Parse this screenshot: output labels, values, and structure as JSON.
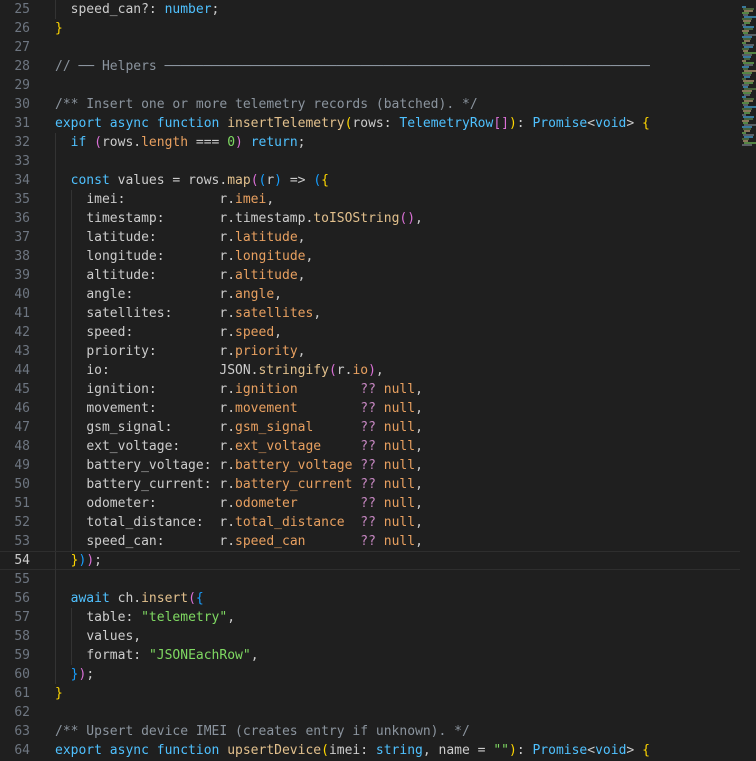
{
  "editor": {
    "language": "typescript",
    "current_line": 54,
    "colors": {
      "background": "#1f1f1f",
      "line_number": "#6e7681",
      "keyword": "#4fc1ff",
      "function": "#e2c08d",
      "property": "#e8a060",
      "string": "#7fd962",
      "comment": "#8b949e",
      "operator": "#c586c0"
    },
    "lines": [
      {
        "n": "25",
        "indent": 1,
        "tokens": [
          [
            "ident",
            "speed_can?: "
          ],
          [
            "kw",
            "number"
          ],
          [
            "ident",
            ";"
          ]
        ]
      },
      {
        "n": "26",
        "indent": 0,
        "tokens": [
          [
            "br1",
            "}"
          ]
        ]
      },
      {
        "n": "27",
        "indent": 0,
        "tokens": []
      },
      {
        "n": "28",
        "indent": 0,
        "tokens": [
          [
            "com",
            "// ── Helpers ──────────────────────────────────────────────────────────────"
          ]
        ]
      },
      {
        "n": "29",
        "indent": 0,
        "tokens": []
      },
      {
        "n": "30",
        "indent": 0,
        "tokens": [
          [
            "com",
            "/** Insert one or more telemetry records (batched). */"
          ]
        ]
      },
      {
        "n": "31",
        "indent": 0,
        "tokens": [
          [
            "kw",
            "export async function "
          ],
          [
            "fn",
            "insertTelemetry"
          ],
          [
            "br1",
            "("
          ],
          [
            "ident",
            "rows: "
          ],
          [
            "ty",
            "TelemetryRow"
          ],
          [
            "br2",
            "[]"
          ],
          [
            "br1",
            ")"
          ],
          [
            "ident",
            ": "
          ],
          [
            "ty",
            "Promise"
          ],
          [
            "ident",
            "<"
          ],
          [
            "ty",
            "void"
          ],
          [
            "ident",
            "> "
          ],
          [
            "br1",
            "{"
          ]
        ]
      },
      {
        "n": "32",
        "indent": 1,
        "tokens": [
          [
            "kw",
            "if "
          ],
          [
            "br2",
            "("
          ],
          [
            "ident",
            "rows."
          ],
          [
            "prop",
            "length"
          ],
          [
            "ident",
            " === "
          ],
          [
            "num",
            "0"
          ],
          [
            "br2",
            ")"
          ],
          [
            "ident",
            " "
          ],
          [
            "kw",
            "return"
          ],
          [
            "ident",
            ";"
          ]
        ]
      },
      {
        "n": "33",
        "indent": 1,
        "tokens": []
      },
      {
        "n": "34",
        "indent": 1,
        "tokens": [
          [
            "kw",
            "const "
          ],
          [
            "ident",
            "values = rows."
          ],
          [
            "fn",
            "map"
          ],
          [
            "br2",
            "("
          ],
          [
            "br3",
            "("
          ],
          [
            "ident",
            "r"
          ],
          [
            "br3",
            ")"
          ],
          [
            "ident",
            " => "
          ],
          [
            "br3",
            "("
          ],
          [
            "br1",
            "{"
          ]
        ]
      },
      {
        "n": "35",
        "indent": 2,
        "tokens": [
          [
            "ident",
            "imei:            r."
          ],
          [
            "prop",
            "imei"
          ],
          [
            "ident",
            ","
          ]
        ]
      },
      {
        "n": "36",
        "indent": 2,
        "tokens": [
          [
            "ident",
            "timestamp:       r.timestamp."
          ],
          [
            "fn",
            "toISOString"
          ],
          [
            "br2",
            "()"
          ],
          [
            "ident",
            ","
          ]
        ]
      },
      {
        "n": "37",
        "indent": 2,
        "tokens": [
          [
            "ident",
            "latitude:        r."
          ],
          [
            "prop",
            "latitude"
          ],
          [
            "ident",
            ","
          ]
        ]
      },
      {
        "n": "38",
        "indent": 2,
        "tokens": [
          [
            "ident",
            "longitude:       r."
          ],
          [
            "prop",
            "longitude"
          ],
          [
            "ident",
            ","
          ]
        ]
      },
      {
        "n": "39",
        "indent": 2,
        "tokens": [
          [
            "ident",
            "altitude:        r."
          ],
          [
            "prop",
            "altitude"
          ],
          [
            "ident",
            ","
          ]
        ]
      },
      {
        "n": "40",
        "indent": 2,
        "tokens": [
          [
            "ident",
            "angle:           r."
          ],
          [
            "prop",
            "angle"
          ],
          [
            "ident",
            ","
          ]
        ]
      },
      {
        "n": "41",
        "indent": 2,
        "tokens": [
          [
            "ident",
            "satellites:      r."
          ],
          [
            "prop",
            "satellites"
          ],
          [
            "ident",
            ","
          ]
        ]
      },
      {
        "n": "42",
        "indent": 2,
        "tokens": [
          [
            "ident",
            "speed:           r."
          ],
          [
            "prop",
            "speed"
          ],
          [
            "ident",
            ","
          ]
        ]
      },
      {
        "n": "43",
        "indent": 2,
        "tokens": [
          [
            "ident",
            "priority:        r."
          ],
          [
            "prop",
            "priority"
          ],
          [
            "ident",
            ","
          ]
        ]
      },
      {
        "n": "44",
        "indent": 2,
        "tokens": [
          [
            "ident",
            "io:              JSON."
          ],
          [
            "fn",
            "stringify"
          ],
          [
            "br2",
            "("
          ],
          [
            "ident",
            "r."
          ],
          [
            "prop",
            "io"
          ],
          [
            "br2",
            ")"
          ],
          [
            "ident",
            ","
          ]
        ]
      },
      {
        "n": "45",
        "indent": 2,
        "tokens": [
          [
            "ident",
            "ignition:        r."
          ],
          [
            "prop",
            "ignition        "
          ],
          [
            "opq",
            "??"
          ],
          [
            "ident",
            " "
          ],
          [
            "null",
            "null"
          ],
          [
            "ident",
            ","
          ]
        ]
      },
      {
        "n": "46",
        "indent": 2,
        "tokens": [
          [
            "ident",
            "movement:        r."
          ],
          [
            "prop",
            "movement        "
          ],
          [
            "opq",
            "??"
          ],
          [
            "ident",
            " "
          ],
          [
            "null",
            "null"
          ],
          [
            "ident",
            ","
          ]
        ]
      },
      {
        "n": "47",
        "indent": 2,
        "tokens": [
          [
            "ident",
            "gsm_signal:      r."
          ],
          [
            "prop",
            "gsm_signal      "
          ],
          [
            "opq",
            "??"
          ],
          [
            "ident",
            " "
          ],
          [
            "null",
            "null"
          ],
          [
            "ident",
            ","
          ]
        ]
      },
      {
        "n": "48",
        "indent": 2,
        "tokens": [
          [
            "ident",
            "ext_voltage:     r."
          ],
          [
            "prop",
            "ext_voltage     "
          ],
          [
            "opq",
            "??"
          ],
          [
            "ident",
            " "
          ],
          [
            "null",
            "null"
          ],
          [
            "ident",
            ","
          ]
        ]
      },
      {
        "n": "49",
        "indent": 2,
        "tokens": [
          [
            "ident",
            "battery_voltage: r."
          ],
          [
            "prop",
            "battery_voltage "
          ],
          [
            "opq",
            "??"
          ],
          [
            "ident",
            " "
          ],
          [
            "null",
            "null"
          ],
          [
            "ident",
            ","
          ]
        ]
      },
      {
        "n": "50",
        "indent": 2,
        "tokens": [
          [
            "ident",
            "battery_current: r."
          ],
          [
            "prop",
            "battery_current "
          ],
          [
            "opq",
            "??"
          ],
          [
            "ident",
            " "
          ],
          [
            "null",
            "null"
          ],
          [
            "ident",
            ","
          ]
        ]
      },
      {
        "n": "51",
        "indent": 2,
        "tokens": [
          [
            "ident",
            "odometer:        r."
          ],
          [
            "prop",
            "odometer        "
          ],
          [
            "opq",
            "??"
          ],
          [
            "ident",
            " "
          ],
          [
            "null",
            "null"
          ],
          [
            "ident",
            ","
          ]
        ]
      },
      {
        "n": "52",
        "indent": 2,
        "tokens": [
          [
            "ident",
            "total_distance:  r."
          ],
          [
            "prop",
            "total_distance  "
          ],
          [
            "opq",
            "??"
          ],
          [
            "ident",
            " "
          ],
          [
            "null",
            "null"
          ],
          [
            "ident",
            ","
          ]
        ]
      },
      {
        "n": "53",
        "indent": 2,
        "tokens": [
          [
            "ident",
            "speed_can:       r."
          ],
          [
            "prop",
            "speed_can       "
          ],
          [
            "opq",
            "??"
          ],
          [
            "ident",
            " "
          ],
          [
            "null",
            "null"
          ],
          [
            "ident",
            ","
          ]
        ]
      },
      {
        "n": "54",
        "indent": 1,
        "tokens": [
          [
            "br1",
            "}"
          ],
          [
            "br3",
            ")"
          ],
          [
            "br2",
            ")"
          ],
          [
            "ident",
            ";"
          ]
        ]
      },
      {
        "n": "55",
        "indent": 1,
        "tokens": []
      },
      {
        "n": "56",
        "indent": 1,
        "tokens": [
          [
            "kw",
            "await "
          ],
          [
            "ident",
            "ch."
          ],
          [
            "fn",
            "insert"
          ],
          [
            "br2",
            "("
          ],
          [
            "br3",
            "{"
          ]
        ]
      },
      {
        "n": "57",
        "indent": 2,
        "tokens": [
          [
            "ident",
            "table: "
          ],
          [
            "str",
            "\"telemetry\""
          ],
          [
            "ident",
            ","
          ]
        ]
      },
      {
        "n": "58",
        "indent": 2,
        "tokens": [
          [
            "ident",
            "values,"
          ]
        ]
      },
      {
        "n": "59",
        "indent": 2,
        "tokens": [
          [
            "ident",
            "format: "
          ],
          [
            "str",
            "\"JSONEachRow\""
          ],
          [
            "ident",
            ","
          ]
        ]
      },
      {
        "n": "60",
        "indent": 1,
        "tokens": [
          [
            "br3",
            "}"
          ],
          [
            "br2",
            ")"
          ],
          [
            "ident",
            ";"
          ]
        ]
      },
      {
        "n": "61",
        "indent": 0,
        "tokens": [
          [
            "br1",
            "}"
          ]
        ]
      },
      {
        "n": "62",
        "indent": 0,
        "tokens": []
      },
      {
        "n": "63",
        "indent": 0,
        "tokens": [
          [
            "com",
            "/** Upsert device IMEI (creates entry if unknown). */"
          ]
        ]
      },
      {
        "n": "64",
        "indent": 0,
        "tokens": [
          [
            "kw",
            "export async function "
          ],
          [
            "fn",
            "upsertDevice"
          ],
          [
            "br1",
            "("
          ],
          [
            "ident",
            "imei: "
          ],
          [
            "kw",
            "string"
          ],
          [
            "ident",
            ", name = "
          ],
          [
            "str",
            "\"\""
          ],
          [
            "br1",
            ")"
          ],
          [
            "ident",
            ": "
          ],
          [
            "ty",
            "Promise"
          ],
          [
            "ident",
            "<"
          ],
          [
            "ty",
            "void"
          ],
          [
            "ident",
            "> "
          ],
          [
            "br1",
            "{"
          ]
        ]
      }
    ]
  }
}
